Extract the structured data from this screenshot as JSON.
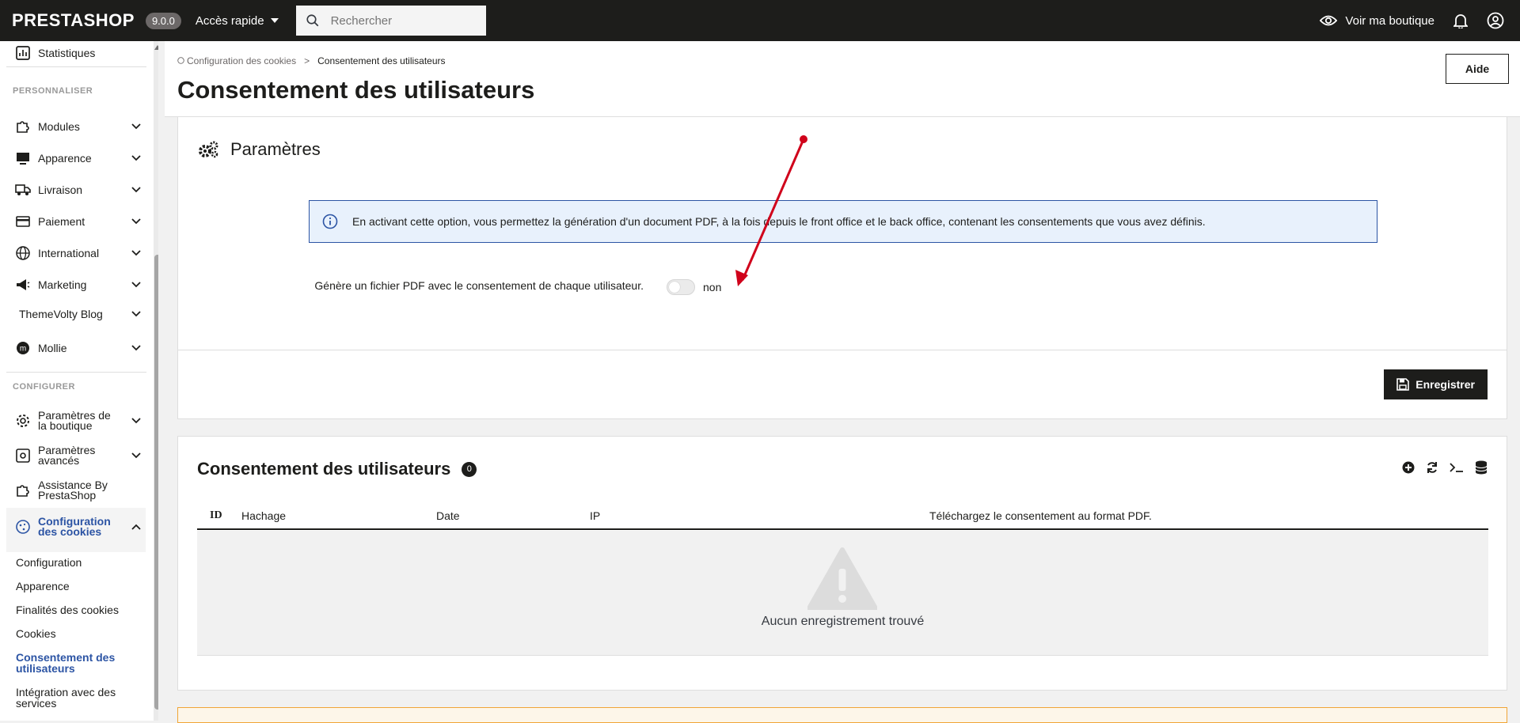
{
  "topbar": {
    "logo": "PRESTASHOP",
    "version": "9.0.0",
    "quick_access": "Accès rapide",
    "search_placeholder": "Rechercher",
    "view_shop": "Voir ma boutique"
  },
  "sidebar": {
    "top_item": "Statistiques",
    "section_personnaliser": "PERSONNALISER",
    "items": [
      {
        "label": "Modules"
      },
      {
        "label": "Apparence"
      },
      {
        "label": "Livraison"
      },
      {
        "label": "Paiement"
      },
      {
        "label": "International"
      },
      {
        "label": "Marketing"
      },
      {
        "label": "ThemeVolty Blog"
      },
      {
        "label": "Mollie"
      }
    ],
    "section_configurer": "CONFIGURER",
    "config_items": [
      {
        "label": "Paramètres de la boutique"
      },
      {
        "label": "Paramètres avancés"
      },
      {
        "label": "Assistance By PrestaShop"
      },
      {
        "label": "Configuration des cookies"
      }
    ],
    "sub_items": [
      {
        "label": "Configuration"
      },
      {
        "label": "Apparence"
      },
      {
        "label": "Finalités des cookies"
      },
      {
        "label": "Cookies"
      },
      {
        "label": "Consentement des utilisateurs"
      },
      {
        "label": "Intégration avec des services"
      }
    ]
  },
  "header": {
    "breadcrumb_parent": "Configuration des cookies",
    "breadcrumb_sep": ">",
    "breadcrumb_current": "Consentement des utilisateurs",
    "title": "Consentement des utilisateurs",
    "help": "Aide"
  },
  "settings_panel": {
    "title": "Paramètres",
    "info": "En activant cette option, vous permettez la génération d'un document PDF, à la fois depuis le front office et le back office, contenant les consentements que vous avez définis.",
    "field_label": "Génère un fichier PDF avec le consentement de chaque utilisateur.",
    "toggle_state": "non",
    "save": "Enregistrer"
  },
  "consent_panel": {
    "title": "Consentement des utilisateurs",
    "count": "0",
    "columns": [
      "ID",
      "Hachage",
      "Date",
      "IP",
      "Téléchargez le consentement au format PDF."
    ],
    "empty": "Aucun enregistrement trouvé"
  },
  "colors": {
    "topbar": "#1d1d1b",
    "active_link": "#2c54a4",
    "info_border": "#2c54a4",
    "info_bg": "#e8f1fc",
    "arrow": "#d0021b"
  }
}
